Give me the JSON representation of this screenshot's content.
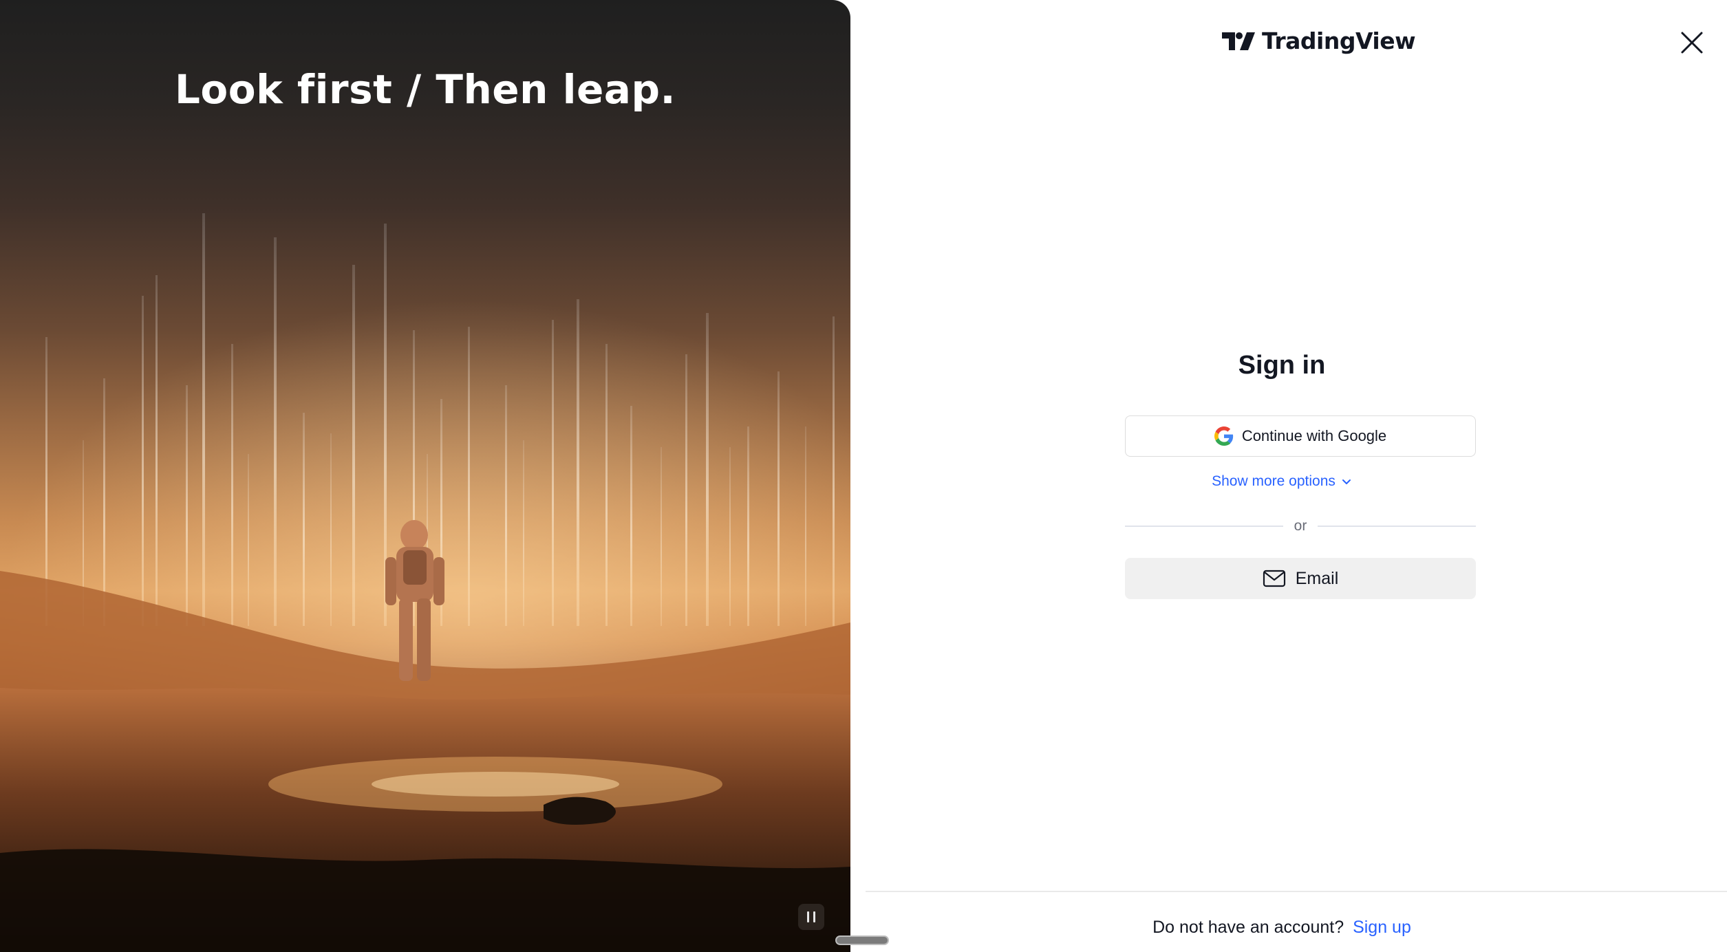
{
  "hero": {
    "headline": "Look first / Then leap."
  },
  "brand": {
    "name": "TradingView"
  },
  "signin": {
    "title": "Sign in",
    "google_label": "Continue with Google",
    "more_options_label": "Show more options",
    "divider_text": "or",
    "email_label": "Email"
  },
  "footer": {
    "prompt": "Do not have an account?",
    "signup_label": "Sign up"
  },
  "colors": {
    "accent_link": "#2962ff",
    "text_primary": "#131722",
    "email_button_bg": "#f0f0f0"
  },
  "icons": {
    "close": "close-icon",
    "google": "google-icon",
    "chevron": "chevron-down-icon",
    "email": "envelope-icon",
    "pause": "pause-icon",
    "logo": "tradingview-logo-icon"
  }
}
